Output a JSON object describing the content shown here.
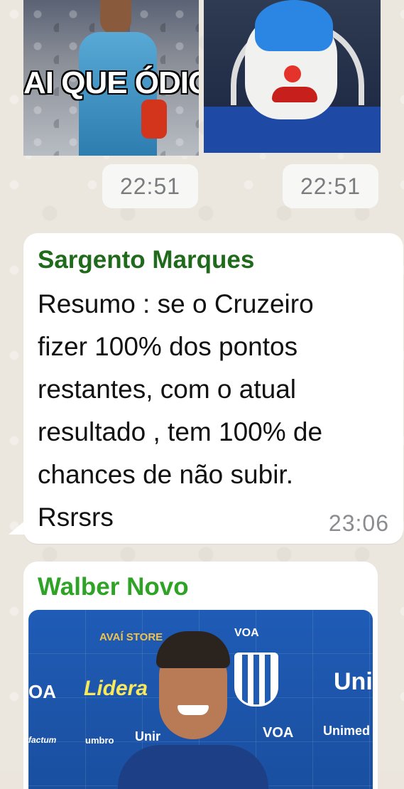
{
  "top_media": {
    "left_caption": "AI QUE ÓDIO",
    "left_time": "22:51",
    "right_time": "22:51"
  },
  "message": {
    "sender": "Sargento Marques",
    "sender_color": "#206a1c",
    "text": "Resumo : se o Cruzeiro\nfizer 100%  dos pontos\nrestantes, com o atual\nresultado , tem 100% de\nchances de não subir.\nRsrsrs",
    "time": "23:06"
  },
  "message2": {
    "sender": "Walber Novo",
    "sender_color": "#2fa326",
    "photo_sponsors": {
      "avai": "AVAÍ STORE",
      "voa1": "VOA",
      "oa": "OA",
      "lidera": "Lidera",
      "uni": "Uni",
      "factum": "factum",
      "umbro": "umbro",
      "unim": "Unir",
      "voa2": "VOA",
      "unimed": "Unimed"
    }
  }
}
